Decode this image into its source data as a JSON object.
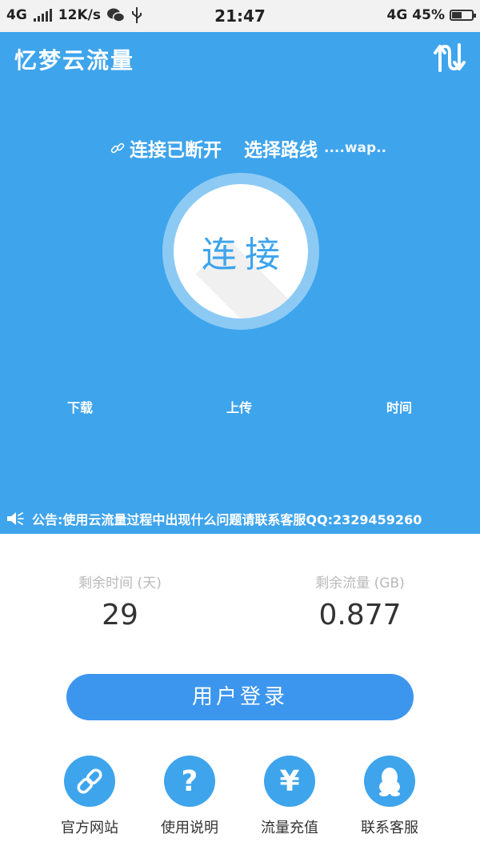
{
  "statusbar": {
    "network_left": "4G",
    "speed": "12K/s",
    "time": "21:47",
    "network_right": "4G",
    "battery": "45%"
  },
  "header": {
    "title": "忆梦云流量"
  },
  "connection": {
    "status": "连接已断开",
    "route_label": "选择路线",
    "route_value": "....wap.."
  },
  "connect_button": {
    "label": "连接"
  },
  "stats": {
    "download_label": "下载",
    "upload_label": "上传",
    "time_label": "时间"
  },
  "notice": {
    "text": "公告:使用云流量过程中出现什么问题请联系客服QQ:2329459260"
  },
  "account": {
    "remaining_time_label": "剩余时间 (天)",
    "remaining_time_value": "29",
    "remaining_data_label": "剩余流量 (GB)",
    "remaining_data_value": "0.877"
  },
  "login_button": {
    "label": "用户登录"
  },
  "actions": [
    {
      "label": "官方网站",
      "icon": "link-icon"
    },
    {
      "label": "使用说明",
      "icon": "question-icon",
      "glyph": "?"
    },
    {
      "label": "流量充值",
      "icon": "yen-icon",
      "glyph": "¥"
    },
    {
      "label": "联系客服",
      "icon": "qq-penguin-icon"
    }
  ],
  "colors": {
    "primary": "#3ea4ec",
    "button": "#3c96ee",
    "ring": "#8ccaf4"
  }
}
